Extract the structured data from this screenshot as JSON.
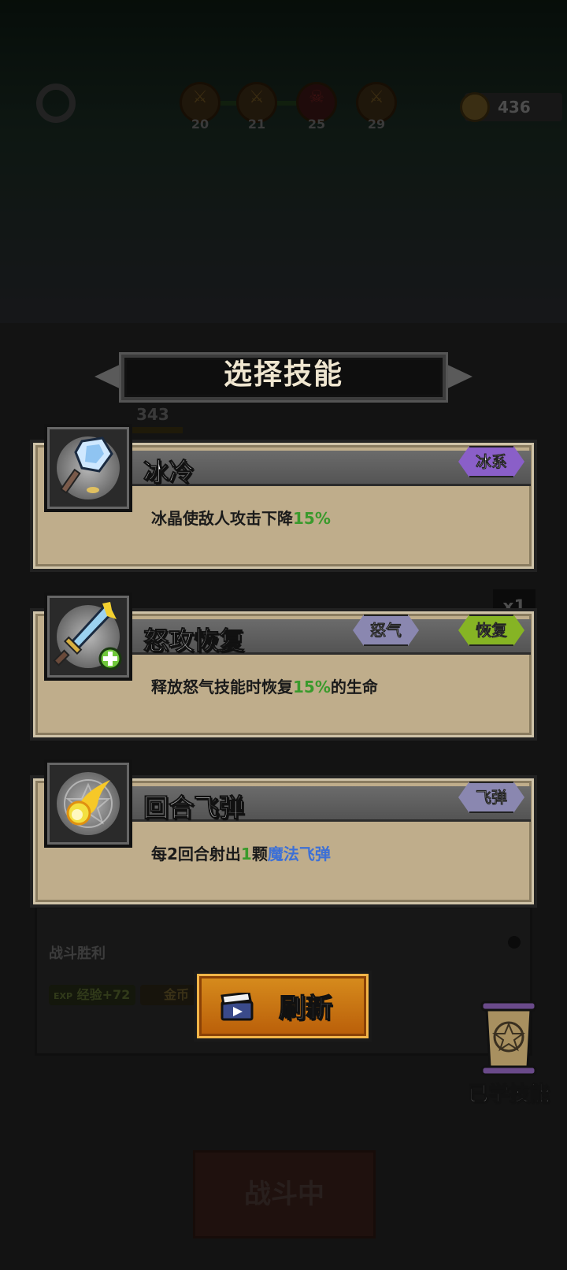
{
  "hud": {
    "stages": [
      {
        "number": "20",
        "icon": "sword-stage-icon"
      },
      {
        "number": "21",
        "icon": "sword-stage-icon"
      },
      {
        "number": "25",
        "icon": "skull-boss-icon"
      },
      {
        "number": "29",
        "icon": "sword-stage-icon"
      }
    ],
    "coins": "436"
  },
  "battle": {
    "hero_hp": "343",
    "speed": "x1",
    "victory_label": "战斗胜利",
    "exp_reward": "经验+72",
    "exp_prefix": "EXP",
    "gold_reward": "金币",
    "fight_button": "战斗中"
  },
  "dialog": {
    "title": "选择技能",
    "skills": [
      {
        "name": "冰冷",
        "icon": "ice-sword-icon",
        "tags": [
          {
            "label": "冰系",
            "color": "#8a5fc8"
          }
        ],
        "desc_parts": [
          "冰晶使敌人攻击下降",
          "15%",
          ""
        ]
      },
      {
        "name": "怒攻恢复",
        "icon": "sword-heal-icon",
        "tags": [
          {
            "label": "怒气",
            "color": "#8a87b0"
          },
          {
            "label": "恢复",
            "color": "#86b424"
          }
        ],
        "desc_parts": [
          "释放怒气技能时恢复",
          "15%",
          "的生命"
        ]
      },
      {
        "name": "回合飞弹",
        "icon": "fireball-icon",
        "tags": [
          {
            "label": "飞弹",
            "color": "#8a87b0"
          }
        ],
        "desc_parts": [
          "每2回合射出",
          "1",
          "颗",
          "魔法飞弹"
        ]
      }
    ],
    "refresh_button": "刷新",
    "learned_skills": "已学技能"
  }
}
